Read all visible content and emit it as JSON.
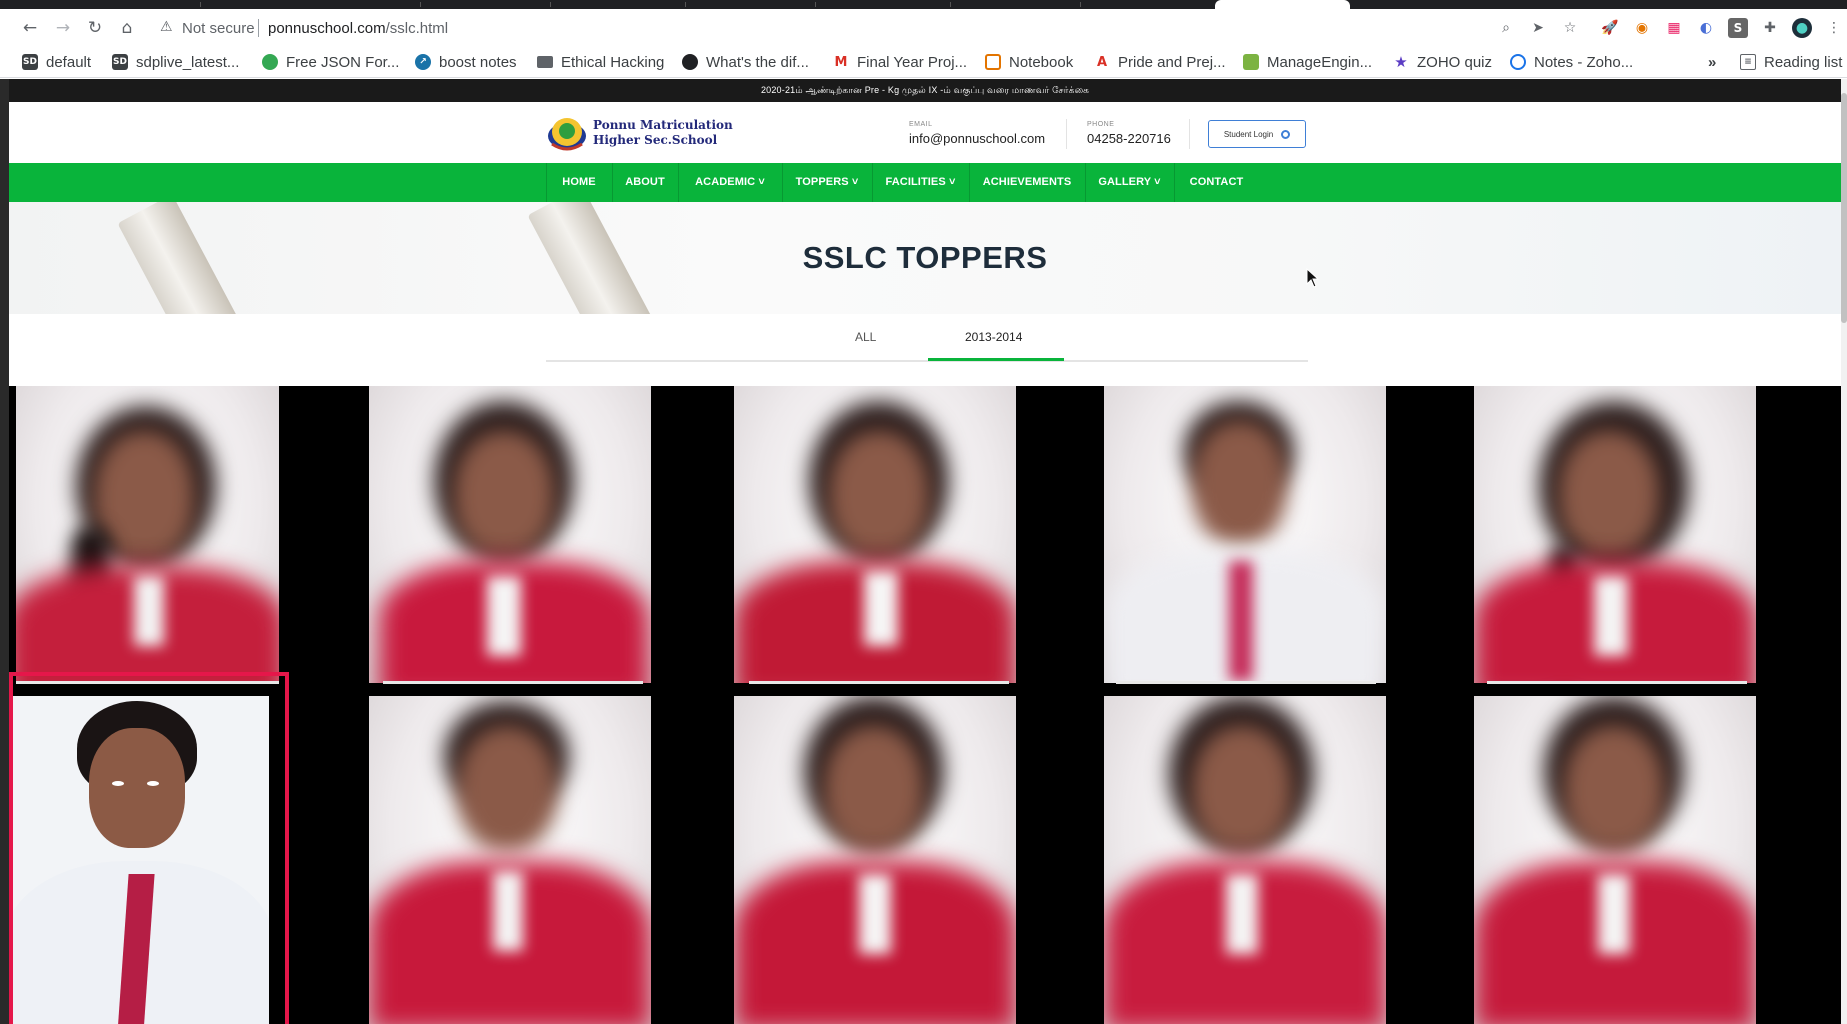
{
  "browser": {
    "security_label": "Not secure",
    "url_host": "ponnuschool.com",
    "url_path": "/sslc.html",
    "bookmarks": [
      {
        "label": "default",
        "icon": "sd-icon",
        "color": "#3c4043"
      },
      {
        "label": "sdplive_latest...",
        "icon": "sd-icon",
        "color": "#3c4043"
      },
      {
        "label": "Free JSON For...",
        "icon": "json-icon",
        "color": "#34a853"
      },
      {
        "label": "boost notes",
        "icon": "boost-icon",
        "color": "#1a73a8"
      },
      {
        "label": "Ethical Hacking",
        "icon": "folder-icon",
        "color": "#5f6368"
      },
      {
        "label": "What's the dif...",
        "icon": "site-icon",
        "color": "#202124"
      },
      {
        "label": "Final Year Proj...",
        "icon": "gmail-icon",
        "color": "#d93025"
      },
      {
        "label": "Notebook",
        "icon": "notebook-icon",
        "color": "#e37400"
      },
      {
        "label": "Pride and Prej...",
        "icon": "book-icon",
        "color": "#d93025"
      },
      {
        "label": "ManageEngin...",
        "icon": "manageengine-icon",
        "color": "#7cb342"
      },
      {
        "label": "ZOHO quiz",
        "icon": "star-icon",
        "color": "#5b3cc4"
      },
      {
        "label": "Notes - Zoho...",
        "icon": "notes-icon",
        "color": "#1a73e8"
      }
    ],
    "overflow_label": "»",
    "reading_list_label": "Reading list"
  },
  "site": {
    "announcement": "2020-21ம் ஆண்டிற்கான Pre - Kg முதல் IX -ம் வகுப்பு வரை மாணவர் சேர்க்கை",
    "school_name_line1": "Ponnu Matriculation",
    "school_name_line2": "Higher Sec.School",
    "email_label": "EMAIL",
    "email_value": "info@ponnuschool.com",
    "phone_label": "PHONE",
    "phone_value": "04258-220716",
    "login_label": "Student Login",
    "nav": [
      {
        "label": "HOME"
      },
      {
        "label": "ABOUT"
      },
      {
        "label": "ACADEMIC ˅"
      },
      {
        "label": "TOPPERS ˅"
      },
      {
        "label": "FACILITIES ˅"
      },
      {
        "label": "ACHIEVEMENTS"
      },
      {
        "label": "GALLERY ˅"
      },
      {
        "label": "CONTACT"
      }
    ],
    "page_title": "SSLC TOPPERS",
    "filters": [
      {
        "label": "ALL",
        "active": false
      },
      {
        "label": "2013-2014",
        "active": true
      }
    ],
    "accent_color": "#09b43b",
    "highlight_color": "#e5174a"
  }
}
